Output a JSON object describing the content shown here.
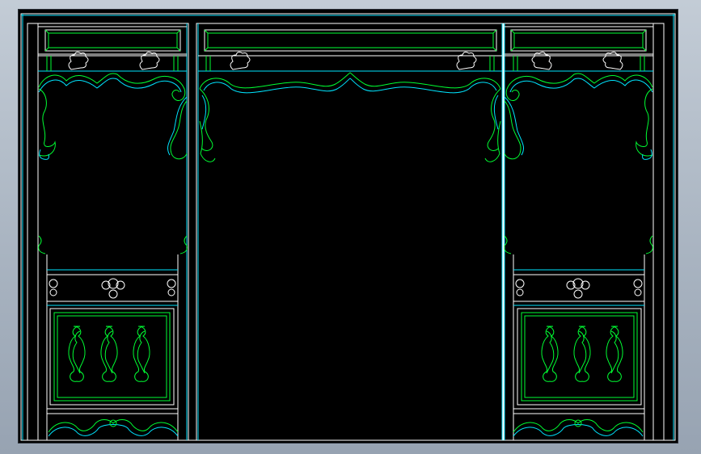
{
  "viewport": {
    "background": "#000000",
    "frame_color": "#ffffff",
    "outline_color": "#00e5ff",
    "ornament_color": "#00ff33"
  },
  "drawing": {
    "description_icon": "cad-drawing-icon",
    "bays": [
      "left-bay",
      "center-bay",
      "right-bay"
    ]
  }
}
